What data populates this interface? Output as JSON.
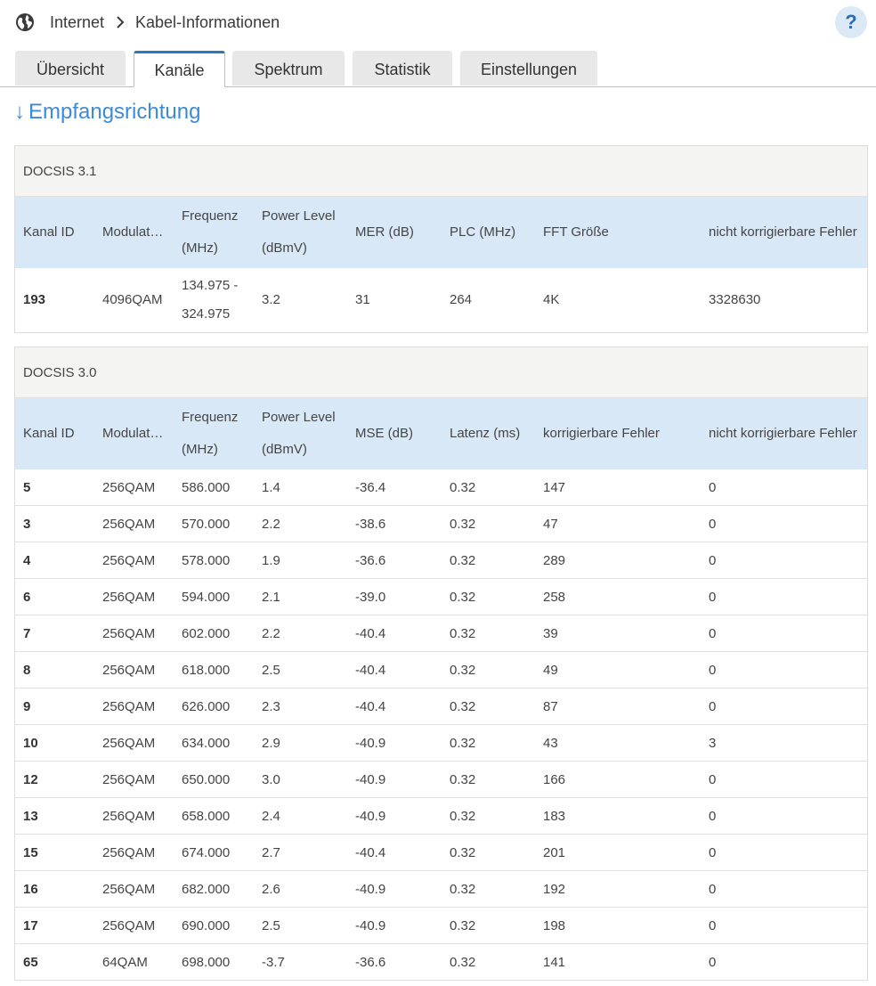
{
  "breadcrumb": {
    "parent": "Internet",
    "current": "Kabel-Informationen"
  },
  "help_label": "?",
  "tabs": [
    {
      "label": "Übersicht"
    },
    {
      "label": "Kanäle"
    },
    {
      "label": "Spektrum"
    },
    {
      "label": "Statistik"
    },
    {
      "label": "Einstellungen"
    }
  ],
  "active_tab": "Kanäle",
  "section": {
    "arrow": "↓",
    "title": "Empfangsrichtung"
  },
  "docsis31": {
    "title": "DOCSIS 3.1",
    "headers": [
      "Kanal ID",
      "Modulat…",
      "Frequenz (MHz)",
      "Power Level (dBmV)",
      "MER (dB)",
      "PLC (MHz)",
      "FFT Größe",
      "nicht korrigierbare Fehler"
    ],
    "rows": [
      [
        "193",
        "4096QAM",
        "134.975 - 324.975",
        "3.2",
        "31",
        "264",
        "4K",
        "3328630"
      ]
    ]
  },
  "docsis30": {
    "title": "DOCSIS 3.0",
    "headers": [
      "Kanal ID",
      "Modulat…",
      "Frequenz (MHz)",
      "Power Level (dBmV)",
      "MSE (dB)",
      "Latenz (ms)",
      "korrigierbare Fehler",
      "nicht korrigierbare Fehler"
    ],
    "rows": [
      [
        "5",
        "256QAM",
        "586.000",
        "1.4",
        "-36.4",
        "0.32",
        "147",
        "0"
      ],
      [
        "3",
        "256QAM",
        "570.000",
        "2.2",
        "-38.6",
        "0.32",
        "47",
        "0"
      ],
      [
        "4",
        "256QAM",
        "578.000",
        "1.9",
        "-36.6",
        "0.32",
        "289",
        "0"
      ],
      [
        "6",
        "256QAM",
        "594.000",
        "2.1",
        "-39.0",
        "0.32",
        "258",
        "0"
      ],
      [
        "7",
        "256QAM",
        "602.000",
        "2.2",
        "-40.4",
        "0.32",
        "39",
        "0"
      ],
      [
        "8",
        "256QAM",
        "618.000",
        "2.5",
        "-40.4",
        "0.32",
        "49",
        "0"
      ],
      [
        "9",
        "256QAM",
        "626.000",
        "2.3",
        "-40.4",
        "0.32",
        "87",
        "0"
      ],
      [
        "10",
        "256QAM",
        "634.000",
        "2.9",
        "-40.9",
        "0.32",
        "43",
        "3"
      ],
      [
        "12",
        "256QAM",
        "650.000",
        "3.0",
        "-40.9",
        "0.32",
        "166",
        "0"
      ],
      [
        "13",
        "256QAM",
        "658.000",
        "2.4",
        "-40.9",
        "0.32",
        "183",
        "0"
      ],
      [
        "15",
        "256QAM",
        "674.000",
        "2.7",
        "-40.4",
        "0.32",
        "201",
        "0"
      ],
      [
        "16",
        "256QAM",
        "682.000",
        "2.6",
        "-40.9",
        "0.32",
        "192",
        "0"
      ],
      [
        "17",
        "256QAM",
        "690.000",
        "2.5",
        "-40.9",
        "0.32",
        "198",
        "0"
      ],
      [
        "65",
        "64QAM",
        "698.000",
        "-3.7",
        "-36.6",
        "0.32",
        "141",
        "0"
      ]
    ]
  },
  "colors": {
    "accent": "#2b78c2",
    "title_blue": "#3d8ad8",
    "header_bg": "#d9e8f6"
  }
}
